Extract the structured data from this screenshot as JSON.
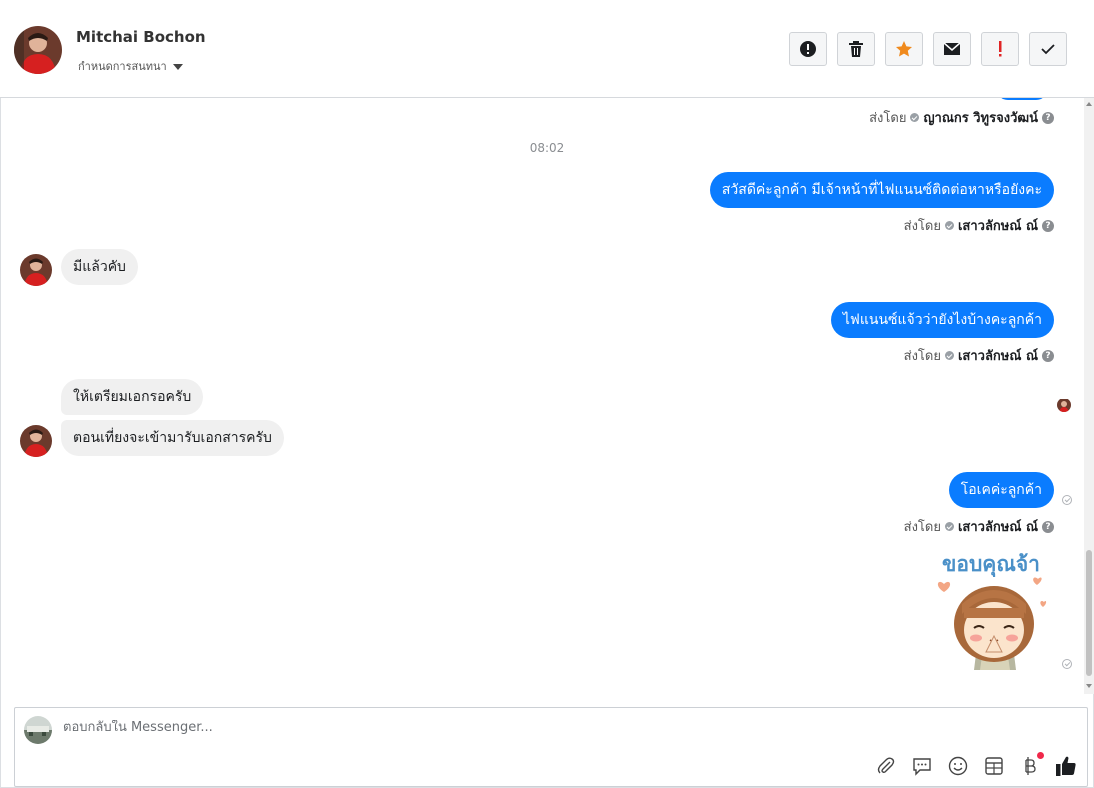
{
  "header": {
    "contact_name": "Mitchai Bochon",
    "conversation_sub": "กำหนดการสนทนา",
    "toolbar": [
      {
        "name": "report-button",
        "icon": "alert-circle-icon"
      },
      {
        "name": "delete-button",
        "icon": "trash-icon"
      },
      {
        "name": "star-button",
        "icon": "star-icon"
      },
      {
        "name": "mark-unread-button",
        "icon": "envelope-icon"
      },
      {
        "name": "important-button",
        "icon": "exclamation-icon"
      },
      {
        "name": "done-button",
        "icon": "check-icon"
      }
    ]
  },
  "colors": {
    "outgoing_bubble": "#0a7cff",
    "incoming_bubble": "#f0f0f0",
    "star": "#f08a1d",
    "important": "#e02424",
    "badge": "#f0284a"
  },
  "messages": {
    "sent_by_label": "ส่งโดย",
    "time_divider": "08:02",
    "first_sender": "ญาณกร วิทูรจงวัฒน์",
    "out1_text": "สวัสดีค่ะลูกค้า มีเจ้าหน้าที่ไฟแนนซ์ติดต่อหาหรือยังคะ",
    "out1_sender": "เสาวลักษณ์ ณ์",
    "in1_text": "มีแล้วคับ",
    "out2_text": "ไฟแนนซ์แจ้วว่ายังไงบ้างคะลูกค้า",
    "out2_sender": "เสาวลักษณ์ ณ์",
    "in2_text": "ให้เตรียมเอกรอครับ",
    "in3_text": "ตอนเที่ยงจะเข้ามารับเอกสารครับ",
    "out3_text": "โอเคค่ะลูกค้า",
    "out3_sender": "เสาวลักษณ์ ณ์",
    "sticker_text": "ขอบคุณจ้า"
  },
  "composer": {
    "placeholder": "ตอบกลับใน Messenger...",
    "tools": [
      "paperclip-icon",
      "saved-reply-icon",
      "emoji-icon",
      "appointment-icon",
      "payment-icon",
      "like-icon"
    ]
  }
}
